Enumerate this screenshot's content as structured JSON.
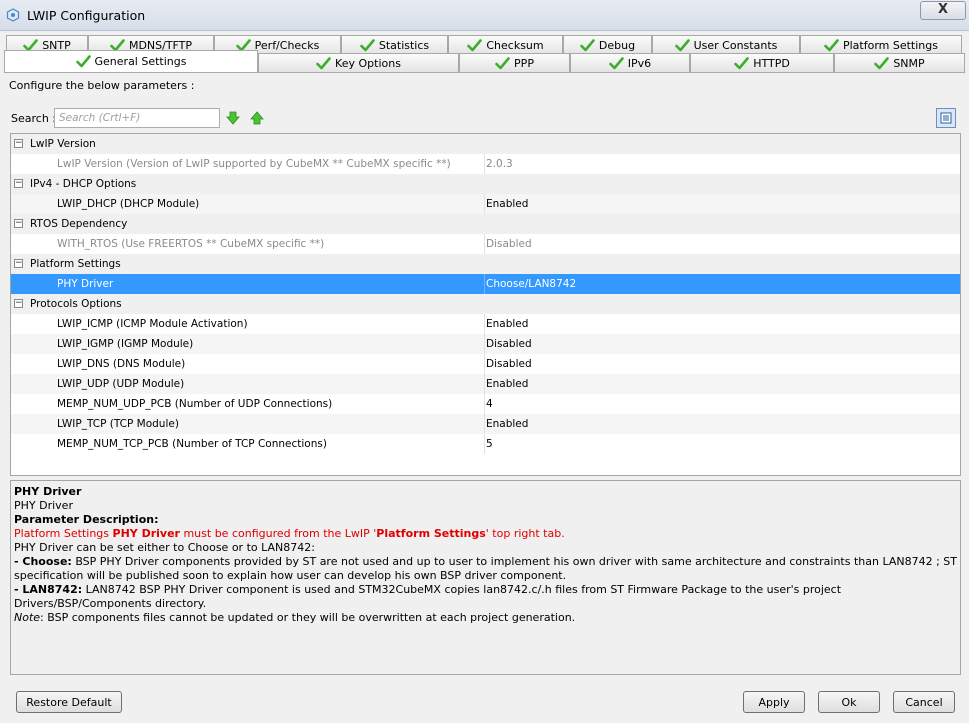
{
  "window": {
    "title": "LWIP Configuration",
    "close_label": "X"
  },
  "tabs_row1": [
    {
      "label": "SNTP"
    },
    {
      "label": "MDNS/TFTP"
    },
    {
      "label": "Perf/Checks"
    },
    {
      "label": "Statistics"
    },
    {
      "label": "Checksum"
    },
    {
      "label": "Debug"
    },
    {
      "label": "User Constants"
    },
    {
      "label": "Platform Settings"
    }
  ],
  "tabs_row2": [
    {
      "label": "General Settings",
      "active": true
    },
    {
      "label": "Key Options"
    },
    {
      "label": "PPP"
    },
    {
      "label": "IPv6"
    },
    {
      "label": "HTTPD"
    },
    {
      "label": "SNMP"
    }
  ],
  "configure_label": "Configure the below parameters :",
  "search": {
    "label": "Search :",
    "placeholder": "Search (Crtl+F)"
  },
  "table": {
    "rows": [
      {
        "type": "group",
        "label": "LwIP Version",
        "toggle": "−"
      },
      {
        "type": "param",
        "name": "LwIP Version (Version of LwIP supported by CubeMX ** CubeMX specific **)",
        "value": "2.0.3",
        "readonly": true
      },
      {
        "type": "group",
        "label": "IPv4 - DHCP Options",
        "toggle": "−"
      },
      {
        "type": "param",
        "name": "LWIP_DHCP (DHCP Module)",
        "value": "Enabled"
      },
      {
        "type": "group",
        "label": "RTOS Dependency",
        "toggle": "−"
      },
      {
        "type": "param",
        "name": "WITH_RTOS (Use FREERTOS ** CubeMX specific **)",
        "value": "Disabled",
        "readonly": true
      },
      {
        "type": "group",
        "label": "Platform Settings",
        "toggle": "−"
      },
      {
        "type": "param",
        "name": "PHY Driver",
        "value": "Choose/LAN8742",
        "selected": true
      },
      {
        "type": "group",
        "label": "Protocols Options",
        "toggle": "−"
      },
      {
        "type": "param",
        "name": "LWIP_ICMP (ICMP Module Activation)",
        "value": "Enabled"
      },
      {
        "type": "param",
        "name": "LWIP_IGMP (IGMP Module)",
        "value": "Disabled"
      },
      {
        "type": "param",
        "name": "LWIP_DNS (DNS Module)",
        "value": "Disabled"
      },
      {
        "type": "param",
        "name": "LWIP_UDP (UDP Module)",
        "value": "Enabled"
      },
      {
        "type": "param",
        "name": "MEMP_NUM_UDP_PCB (Number of UDP Connections)",
        "value": "4"
      },
      {
        "type": "param",
        "name": "LWIP_TCP (TCP Module)",
        "value": "Enabled"
      },
      {
        "type": "param",
        "name": "MEMP_NUM_TCP_PCB (Number of TCP Connections)",
        "value": "5"
      }
    ]
  },
  "description": {
    "title": "PHY Driver",
    "subtitle": "PHY Driver",
    "param_desc_label": "Parameter Description:",
    "warn_1": "Platform Settings ",
    "warn_bold_1": "PHY Driver",
    "warn_2": " must be configured from the LwIP '",
    "warn_bold_2": "Platform Settings",
    "warn_3": "' top right tab.",
    "line_choose_intro": "PHY Driver can be set either to Choose or to LAN8742:",
    "choose_label": "- Choose:",
    "choose_text": " BSP PHY Driver components provided by ST are not used and up to user to implement his own driver with same architecture and constraints than LAN8742 ; ST specification will be published soon to explain how user can develop his own BSP driver component.",
    "lan_label": "- LAN8742:",
    "lan_text": " LAN8742 BSP PHY Driver component is used and STM32CubeMX copies lan8742.c/.h files from ST Firmware Package to the user's project Drivers/BSP/Components directory.",
    "note_label": "Note",
    "note_text": ": BSP components files cannot be updated or they will be overwritten at each project generation."
  },
  "buttons": {
    "restore_default": "Restore Default",
    "apply": "Apply",
    "ok": "Ok",
    "cancel": "Cancel"
  },
  "colors": {
    "selection": "#3399ff",
    "check_green": "#3cae2c",
    "warning_red": "#e00000"
  }
}
